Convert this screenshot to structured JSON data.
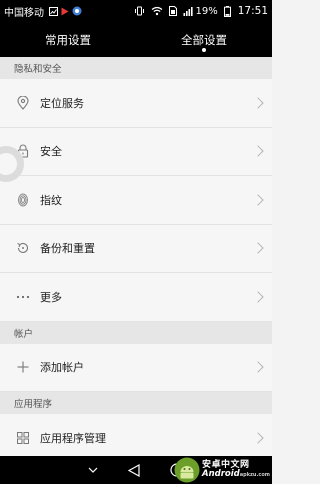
{
  "status_bar": {
    "carrier": "中国移动",
    "battery_percent": "19%",
    "time": "17:51"
  },
  "tabs": [
    {
      "label": "常用设置",
      "selected": false
    },
    {
      "label": "全部设置",
      "selected": true
    }
  ],
  "sections": [
    {
      "header": "隐私和安全",
      "items": [
        {
          "label": "定位服务",
          "icon": "location-pin-icon"
        },
        {
          "label": "安全",
          "icon": "lock-icon"
        },
        {
          "label": "指纹",
          "icon": "fingerprint-icon"
        },
        {
          "label": "备份和重置",
          "icon": "backup-restore-icon"
        },
        {
          "label": "更多",
          "icon": "more-dots-icon"
        }
      ]
    },
    {
      "header": "帐户",
      "items": [
        {
          "label": "添加帐户",
          "icon": "plus-icon"
        }
      ]
    },
    {
      "header": "应用程序",
      "items": [
        {
          "label": "应用程序管理",
          "icon": "apps-grid-icon"
        }
      ]
    }
  ],
  "watermark": {
    "cn": "安卓中文网",
    "en": "Android",
    "domain": "apkzu.com"
  }
}
